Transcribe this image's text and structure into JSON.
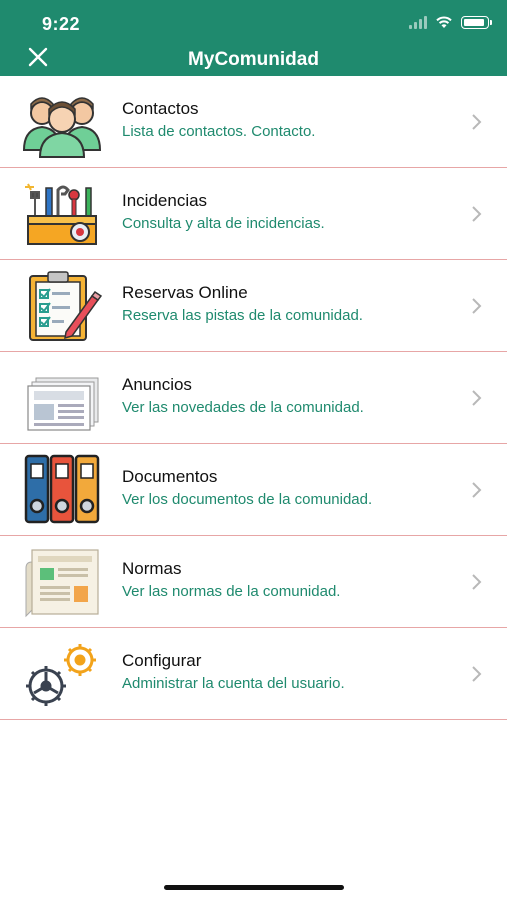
{
  "status_bar": {
    "time": "9:22"
  },
  "header": {
    "title": "MyComunidad",
    "close_icon": "close-icon"
  },
  "menu": [
    {
      "title": "Contactos",
      "subtitle": "Lista de contactos. Contacto.",
      "icon": "people-icon"
    },
    {
      "title": "Incidencias",
      "subtitle": "Consulta y alta de incidencias.",
      "icon": "tools-icon"
    },
    {
      "title": "Reservas Online",
      "subtitle": "Reserva las pistas de la comunidad.",
      "icon": "checklist-icon"
    },
    {
      "title": "Anuncios",
      "subtitle": "Ver las novedades de la comunidad.",
      "icon": "newspaper-icon"
    },
    {
      "title": "Documentos",
      "subtitle": "Ver los documentos de la comunidad.",
      "icon": "binders-icon"
    },
    {
      "title": "Normas",
      "subtitle": "Ver las normas de la comunidad.",
      "icon": "rules-document-icon"
    },
    {
      "title": "Configurar",
      "subtitle": "Administrar la cuenta del usuario.",
      "icon": "gears-icon"
    }
  ],
  "colors": {
    "header": "#1f8a6e",
    "subtitle": "#1f8a6e",
    "divider": "#e7a6a6"
  }
}
